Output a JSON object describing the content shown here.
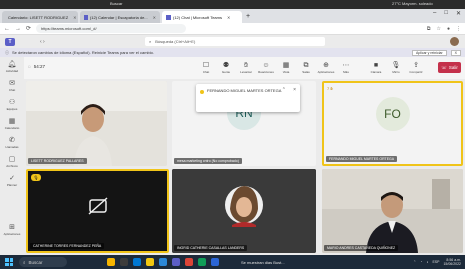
{
  "os_top": {
    "left_text": "Buscar",
    "weather": "27°C Mayorm. soleado"
  },
  "tabs": [
    {
      "label": "Calendario: LISETT RODRIGUEZ",
      "active": false
    },
    {
      "label": "(12) Calendar | Escapatoria de...",
      "active": false
    },
    {
      "label": "(12) Chat | Microsoft Teams",
      "active": true
    }
  ],
  "address_bar": {
    "url": "https://teams.microsoft.com/_#/"
  },
  "teams_header": {
    "search_placeholder": "Búsqueda (Ctrl+Alt+E)"
  },
  "banner": {
    "text": "Se detectaron cambios de idioma (Español). Reinicie Teams para ver el cambio.",
    "apply_label": "Aplicar y reiniciar",
    "close_label": "X"
  },
  "rail": [
    {
      "label": "Actividad",
      "icon": "bell-icon"
    },
    {
      "label": "Chat",
      "icon": "chat-icon"
    },
    {
      "label": "Equipos",
      "icon": "teams-icon"
    },
    {
      "label": "Calendario",
      "icon": "calendar-icon"
    },
    {
      "label": "Llamadas",
      "icon": "phone-icon"
    },
    {
      "label": "Archivos",
      "icon": "file-icon"
    },
    {
      "label": "Planner",
      "icon": "check-icon"
    },
    {
      "label": "Aplicaciones",
      "icon": "apps-icon"
    }
  ],
  "meeting": {
    "timer": "54:27",
    "tools": [
      {
        "label": "Chat",
        "icon": "chat-icon"
      },
      {
        "label": "Gente",
        "icon": "people-icon"
      },
      {
        "label": "Levantar",
        "icon": "hand-icon"
      },
      {
        "label": "Reacciones",
        "icon": "smile-icon"
      },
      {
        "label": "Vista",
        "icon": "grid-icon"
      },
      {
        "label": "Salas",
        "icon": "rooms-icon"
      },
      {
        "label": "Aplicaciones",
        "icon": "plus-icon"
      },
      {
        "label": "Más",
        "icon": "more-icon"
      },
      {
        "label": "Cámara",
        "icon": "camera-icon"
      },
      {
        "label": "Micro",
        "icon": "mic-icon"
      },
      {
        "label": "Compartir",
        "icon": "share-icon"
      }
    ],
    "leave_label": "Salir"
  },
  "participants": [
    {
      "name": "LISETT RODRIGUEZ PALLARES"
    },
    {
      "name": "mesa marketing cntro (No comprobado)",
      "initials": "RN"
    },
    {
      "name": "FERNANDO MIGUEL MARTES ORTEGA",
      "initials": "FO"
    },
    {
      "name": "CATHERINE TORRES FERNANDEZ PEÑA"
    },
    {
      "name": "INGRID CATHERIE CASALLAS LANDERS"
    },
    {
      "name": "MARIO ANDRES CASTAÑEDA QUIÑONEZ"
    }
  ],
  "notification": {
    "text": "FERNANDO MIGUEL MARTES ORTEGA"
  },
  "taskbar": {
    "search": "Buscar",
    "share_text": "Se muestran dias Bust...",
    "lang": "ESP",
    "time": "8:56 a.m.",
    "date": "15/06/2022"
  }
}
